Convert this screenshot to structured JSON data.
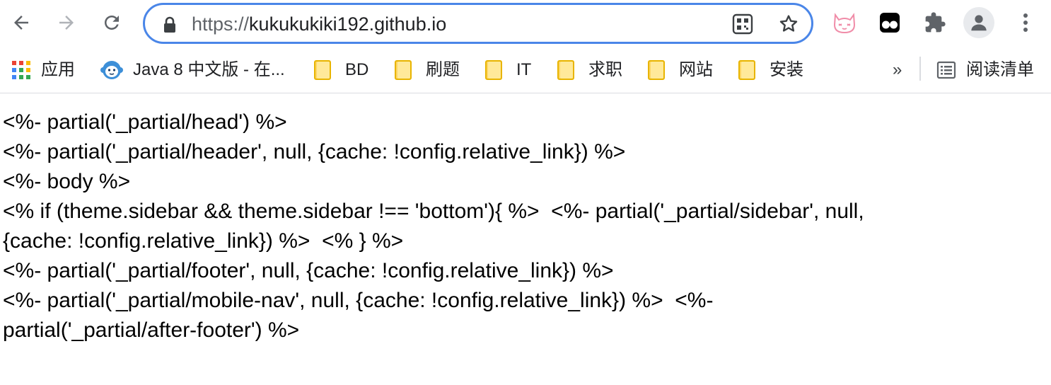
{
  "toolbar": {
    "url_scheme": "https://",
    "url_host": "kukukukiki192.github.io",
    "back_icon": "back-arrow-icon",
    "forward_icon": "forward-arrow-icon",
    "reload_icon": "reload-icon"
  },
  "bookmarks": {
    "items": [
      {
        "label": "应用",
        "icon": "apps-grid-icon"
      },
      {
        "label": "Java 8 中文版 - 在...",
        "icon": "monkey-icon"
      },
      {
        "label": "BD",
        "icon": "folder-icon"
      },
      {
        "label": "刷题",
        "icon": "folder-icon"
      },
      {
        "label": "IT",
        "icon": "folder-icon"
      },
      {
        "label": "求职",
        "icon": "folder-icon"
      },
      {
        "label": "网站",
        "icon": "folder-icon"
      },
      {
        "label": "安装",
        "icon": "folder-icon"
      }
    ],
    "overflow_label": "»",
    "reading_list_label": "阅读清单"
  },
  "content": {
    "lines": [
      "<%- partial('_partial/head') %>",
      "<%- partial('_partial/header', null, {cache: !config.relative_link}) %>",
      "<%- body %>",
      "<% if (theme.sidebar && theme.sidebar !== 'bottom'){ %>  <%- partial('_partial/sidebar', null,",
      "{cache: !config.relative_link}) %>  <% } %>",
      "<%- partial('_partial/footer', null, {cache: !config.relative_link}) %>",
      "<%- partial('_partial/mobile-nav', null, {cache: !config.relative_link}) %>  <%-",
      "partial('_partial/after-footer') %>"
    ]
  },
  "colors": {
    "omnibox_focus": "#4a86e8",
    "folder": "#fdd663",
    "icon_gray": "#5f6368"
  }
}
